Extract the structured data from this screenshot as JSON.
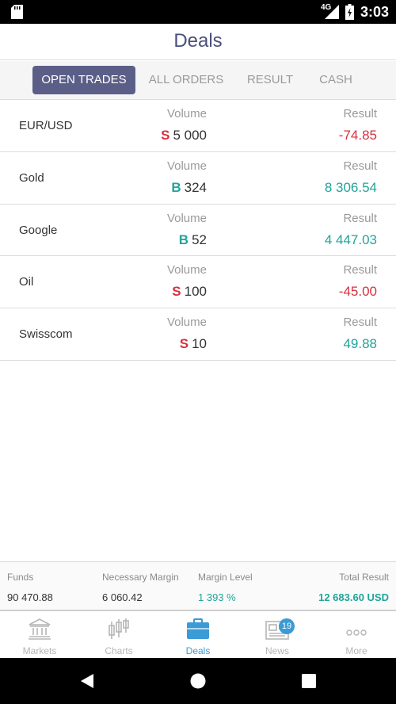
{
  "status_bar": {
    "network": "4G",
    "time": "3:03"
  },
  "header": {
    "title": "Deals"
  },
  "tabs": [
    {
      "label": "OPEN TRADES",
      "active": true
    },
    {
      "label": "ALL ORDERS",
      "active": false
    },
    {
      "label": "RESULT",
      "active": false
    },
    {
      "label": "CASH",
      "active": false
    }
  ],
  "trades": [
    {
      "instrument": "EUR/USD",
      "volume_label": "Volume",
      "side": "S",
      "volume": "5 000",
      "result_label": "Result",
      "result": "-74.85",
      "result_sign": "neg"
    },
    {
      "instrument": "Gold",
      "volume_label": "Volume",
      "side": "B",
      "volume": "324",
      "result_label": "Result",
      "result": "8 306.54",
      "result_sign": "pos"
    },
    {
      "instrument": "Google",
      "volume_label": "Volume",
      "side": "B",
      "volume": "52",
      "result_label": "Result",
      "result": "4 447.03",
      "result_sign": "pos"
    },
    {
      "instrument": "Oil",
      "volume_label": "Volume",
      "side": "S",
      "volume": "100",
      "result_label": "Result",
      "result": "-45.00",
      "result_sign": "neg"
    },
    {
      "instrument": "Swisscom",
      "volume_label": "Volume",
      "side": "S",
      "volume": "10",
      "result_label": "Result",
      "result": "49.88",
      "result_sign": "pos"
    }
  ],
  "summary": [
    {
      "label": "Funds",
      "value": "90 470.88"
    },
    {
      "label": "Necessary Margin",
      "value": "6 060.42"
    },
    {
      "label": "Margin Level",
      "value": "1 393 %"
    },
    {
      "label": "Total Result",
      "value": "12 683.60 USD"
    }
  ],
  "bottom_nav": [
    {
      "label": "Markets",
      "icon": "bank-icon",
      "active": false
    },
    {
      "label": "Charts",
      "icon": "candlestick-icon",
      "active": false
    },
    {
      "label": "Deals",
      "icon": "briefcase-icon",
      "active": true
    },
    {
      "label": "News",
      "icon": "newspaper-icon",
      "active": false,
      "badge": "19"
    },
    {
      "label": "More",
      "icon": "more-dots-icon",
      "active": false
    }
  ],
  "colors": {
    "brand": "#5b5f88",
    "title": "#4a4f7a",
    "sell": "#d7303e",
    "buy": "#1fa59a",
    "nav_active": "#3a9bd5"
  }
}
